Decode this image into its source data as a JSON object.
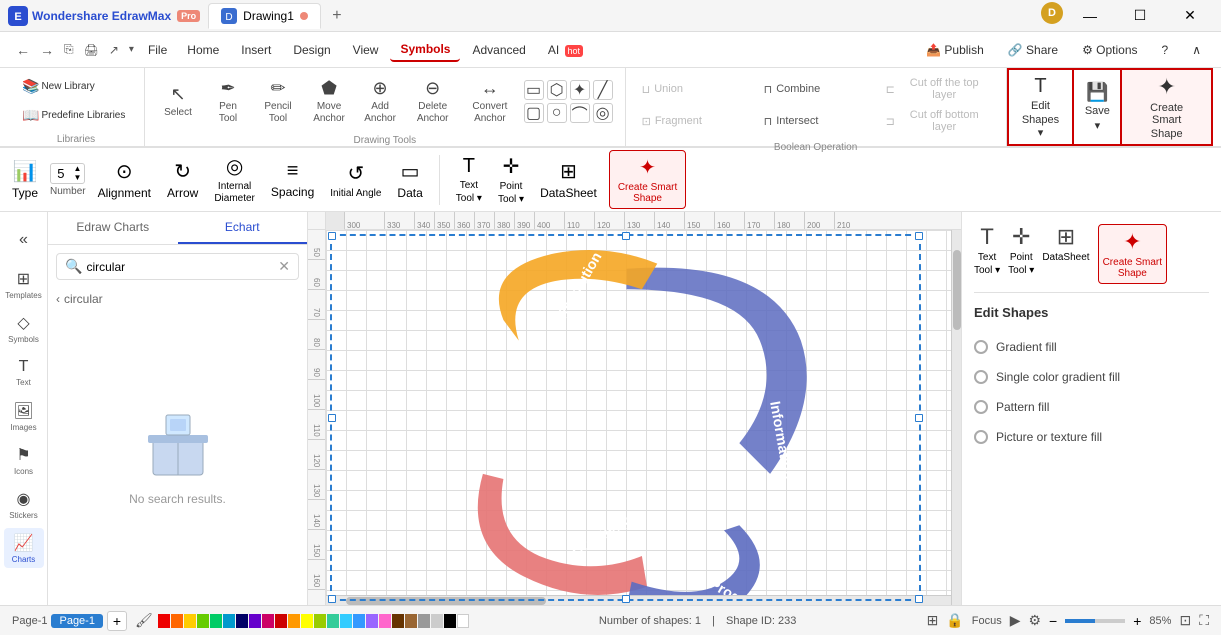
{
  "app": {
    "name": "Wondershare EdrawMax",
    "badge": "Pro",
    "tab1": "Drawing1",
    "tab_dot_color": "#e87766",
    "avatar_letter": "D"
  },
  "window_controls": {
    "minimize": "—",
    "maximize": "☐",
    "close": "✕"
  },
  "menu": {
    "nav_back": "←",
    "nav_fwd": "→",
    "file": "File",
    "items": [
      "Home",
      "Insert",
      "Design",
      "View",
      "Symbols",
      "Advanced",
      "AI"
    ],
    "active_item": "Symbols",
    "right": [
      "Publish",
      "Share",
      "Options",
      "?",
      "∧"
    ]
  },
  "toolbar": {
    "new_library": "New Library",
    "predefine_libraries": "Predefine Libraries",
    "libraries_label": "Libraries",
    "drawing_tools_label": "Drawing Tools",
    "boolean_label": "Boolean Operation",
    "tools": [
      {
        "id": "select",
        "icon": "↖",
        "label": "Select"
      },
      {
        "id": "pen",
        "icon": "✒",
        "label": "Pen Tool"
      },
      {
        "id": "pencil",
        "icon": "✏",
        "label": "Pencil Tool"
      },
      {
        "id": "move-anchor",
        "icon": "⬡",
        "label": "Move Anchor"
      },
      {
        "id": "add-anchor",
        "icon": "⊕",
        "label": "Add Anchor"
      },
      {
        "id": "delete-anchor",
        "icon": "⊖",
        "label": "Delete Anchor"
      },
      {
        "id": "convert-anchor",
        "icon": "↔",
        "label": "Convert Anchor"
      }
    ],
    "shapes": [
      "▭",
      "⬡",
      "⭐",
      "╱",
      "▭",
      "◯",
      "⌒",
      "◎"
    ],
    "bool": {
      "union": "Union",
      "combine": "Combine",
      "cut_top": "Cut off the top layer",
      "fragment": "Fragment",
      "intersect": "Intersect",
      "cut_bottom": "Cut off bottom layer"
    },
    "edit_shapes": "Edit\nShapes",
    "save": "Save",
    "create_smart": "Create Smart\nShape"
  },
  "chart_toolbar": {
    "tools": [
      {
        "id": "type",
        "icon": "📊",
        "label": "Type"
      },
      {
        "id": "number",
        "icon": "5",
        "label": "Number"
      },
      {
        "id": "alignment",
        "icon": "⊙",
        "label": "Alignment"
      },
      {
        "id": "arrow",
        "icon": "⟳",
        "label": "Arrow"
      },
      {
        "id": "internal-diameter",
        "icon": "⊙",
        "label": "Internal\nDiameter"
      },
      {
        "id": "spacing",
        "icon": "≡",
        "label": "Spacing"
      },
      {
        "id": "initial-angle",
        "icon": "⟳",
        "label": "Initial Angle"
      },
      {
        "id": "data",
        "icon": "▭",
        "label": "Data"
      }
    ],
    "text_tool": "Text\nTool",
    "point_tool": "Point\nTool",
    "datasheet": "DataSheet",
    "create_smart_shape": "Create Smart\nShape"
  },
  "sidebar": {
    "items": [
      {
        "id": "collapse",
        "icon": "«",
        "label": ""
      },
      {
        "id": "templates",
        "icon": "⊞",
        "label": "Templates"
      },
      {
        "id": "symbols",
        "icon": "◇",
        "label": "Symbols"
      },
      {
        "id": "text",
        "icon": "T",
        "label": "Text"
      },
      {
        "id": "images",
        "icon": "🖼",
        "label": "Images"
      },
      {
        "id": "icons",
        "icon": "⚑",
        "label": "Icons"
      },
      {
        "id": "stickers",
        "icon": "◉",
        "label": "Stickers"
      },
      {
        "id": "charts",
        "icon": "📈",
        "label": "Charts"
      }
    ],
    "active": "charts"
  },
  "library": {
    "tabs": [
      "Edraw Charts",
      "Echart"
    ],
    "active_tab": "Echart",
    "search_placeholder": "circular",
    "search_value": "circular",
    "breadcrumb_arrow": "‹",
    "breadcrumb_label": "circular",
    "no_results": "No search results."
  },
  "right_panel": {
    "title": "Edit Shapes",
    "options": [
      "Gradient fill",
      "Single color gradient fill",
      "Pattern fill",
      "Picture or texture fill"
    ]
  },
  "canvas": {
    "ruler_marks": [
      "300",
      "330",
      "340",
      "350",
      "360",
      "370",
      "380",
      "390",
      "400",
      "110",
      "120",
      "130",
      "140",
      "150",
      "160",
      "170",
      "180",
      "200",
      "210"
    ],
    "shape_count": "1",
    "shape_id": "233"
  },
  "status_bar": {
    "page_label": "Page-1",
    "page_tab": "Page-1",
    "add_page": "+",
    "shape_count_label": "Number of shapes:",
    "shape_count": "1",
    "shape_id_label": "Shape ID:",
    "shape_id": "233",
    "focus_label": "Focus",
    "zoom_out": "−",
    "zoom_in": "+",
    "zoom_level": "85%"
  },
  "colors": {
    "accent_blue": "#2a4dd0",
    "active_tab": "#2a7dd0",
    "highlight_red": "#cc0000",
    "chart_arrow1": "#f5a623",
    "chart_arrow2": "#e57373",
    "chart_arrow3": "#5c6bc0",
    "chart_arrow4": "#64b5f6"
  }
}
